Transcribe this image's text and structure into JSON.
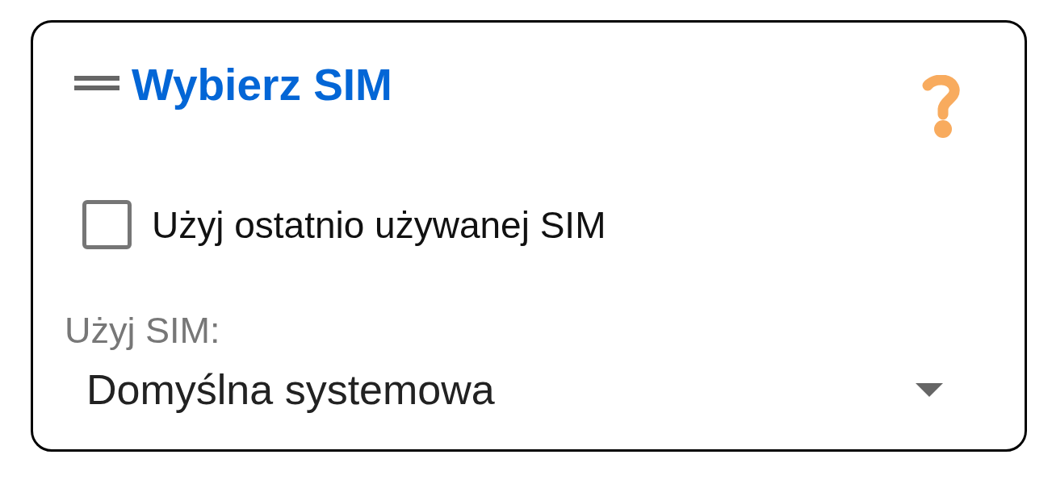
{
  "header": {
    "title": "Wybierz SIM"
  },
  "options": [
    {
      "kind": "checkbox",
      "label": "Użyj ostatnio używanej SIM",
      "checked": false
    },
    {
      "kind": "dropdown",
      "label": "Użyj SIM:",
      "value": "Domyślna systemowa"
    }
  ]
}
